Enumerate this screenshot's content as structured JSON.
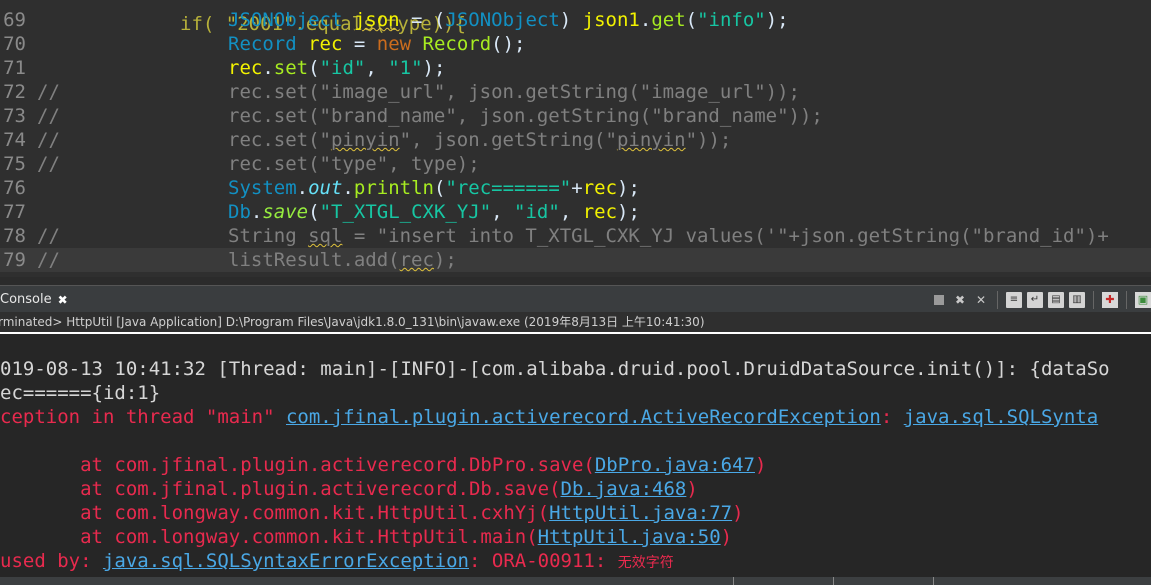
{
  "editor": {
    "top_fragment": "if( \"2001\".equals(type)){",
    "lines": [
      {
        "num": "69",
        "comment": "",
        "tokens": [
          {
            "t": "JSONObject",
            "c": "type"
          },
          {
            "t": " "
          },
          {
            "t": "json",
            "c": "var",
            "sq": true
          },
          {
            "t": " = ("
          },
          {
            "t": "JSONObject",
            "c": "type"
          },
          {
            "t": ") "
          },
          {
            "t": "json1",
            "c": "var"
          },
          {
            "t": "."
          },
          {
            "t": "get",
            "c": "method"
          },
          {
            "t": "("
          },
          {
            "t": "\"info\"",
            "c": "str"
          },
          {
            "t": ");"
          }
        ]
      },
      {
        "num": "70",
        "comment": "",
        "tokens": [
          {
            "t": "Record",
            "c": "type"
          },
          {
            "t": " "
          },
          {
            "t": "rec",
            "c": "var"
          },
          {
            "t": " = "
          },
          {
            "t": "new",
            "c": "kw"
          },
          {
            "t": " "
          },
          {
            "t": "Record",
            "c": "method"
          },
          {
            "t": "();"
          }
        ]
      },
      {
        "num": "71",
        "comment": "",
        "tokens": [
          {
            "t": "rec",
            "c": "var"
          },
          {
            "t": "."
          },
          {
            "t": "set",
            "c": "method"
          },
          {
            "t": "("
          },
          {
            "t": "\"id\"",
            "c": "str"
          },
          {
            "t": ", "
          },
          {
            "t": "\"1\"",
            "c": "str"
          },
          {
            "t": ");"
          }
        ]
      },
      {
        "num": "72",
        "comment": "//",
        "tokens": [
          {
            "t": "rec.set(\"image_url\", json.getString(\"image_url\"));",
            "c": "cm"
          }
        ]
      },
      {
        "num": "73",
        "comment": "//",
        "tokens": [
          {
            "t": "rec.set(\"brand_name\", json.getString(\"brand_name\"));",
            "c": "cm"
          }
        ]
      },
      {
        "num": "74",
        "comment": "//",
        "tokens": [
          {
            "t": "rec.set(\"",
            "c": "cm"
          },
          {
            "t": "pinyin",
            "c": "cm",
            "sq": true
          },
          {
            "t": "\", json.getString(\"",
            "c": "cm"
          },
          {
            "t": "pinyin",
            "c": "cm",
            "sq": true
          },
          {
            "t": "\"));",
            "c": "cm"
          }
        ]
      },
      {
        "num": "75",
        "comment": "//",
        "tokens": [
          {
            "t": "rec.set(\"type\", type);",
            "c": "cm"
          }
        ]
      },
      {
        "num": "76",
        "comment": "",
        "tokens": [
          {
            "t": "System",
            "c": "type"
          },
          {
            "t": "."
          },
          {
            "t": "out",
            "c": "field"
          },
          {
            "t": "."
          },
          {
            "t": "println",
            "c": "method"
          },
          {
            "t": "("
          },
          {
            "t": "\"rec======\"",
            "c": "str"
          },
          {
            "t": "+"
          },
          {
            "t": "rec",
            "c": "var"
          },
          {
            "t": ");"
          }
        ]
      },
      {
        "num": "77",
        "comment": "",
        "tokens": [
          {
            "t": "Db",
            "c": "type"
          },
          {
            "t": "."
          },
          {
            "t": "save",
            "c": "smethod"
          },
          {
            "t": "("
          },
          {
            "t": "\"T_XTGL_CXK_YJ\"",
            "c": "str"
          },
          {
            "t": ", "
          },
          {
            "t": "\"id\"",
            "c": "str"
          },
          {
            "t": ", "
          },
          {
            "t": "rec",
            "c": "var"
          },
          {
            "t": ");"
          }
        ]
      },
      {
        "num": "78",
        "comment": "//",
        "tokens": [
          {
            "t": "String ",
            "c": "cm"
          },
          {
            "t": "sql",
            "c": "cm",
            "sq": true
          },
          {
            "t": " = \"insert into T_XTGL_CXK_YJ values('\"+json.getString(\"brand_id\")+",
            "c": "cm"
          }
        ]
      },
      {
        "num": "79",
        "comment": "//",
        "current": true,
        "tokens": [
          {
            "t": "listResult.add(",
            "c": "cm"
          },
          {
            "t": "rec",
            "c": "cm",
            "sq": true
          },
          {
            "t": ");",
            "c": "cm"
          }
        ]
      }
    ]
  },
  "console": {
    "tab_label": "Console",
    "status": "rminated> HttpUtil [Java Application] D:\\Program Files\\Java\\jdk1.8.0_131\\bin\\javaw.exe (2019年8月13日 上午10:41:30)",
    "toolbar_icons": [
      "terminate-icon",
      "remove-launch-icon",
      "remove-all-icon",
      "scroll-lock-icon",
      "word-wrap-icon",
      "show-stdout-icon",
      "show-stderr-icon",
      "pin-console-icon",
      "open-console-icon"
    ],
    "output": [
      {
        "kind": "info",
        "parts": [
          {
            "t": "019-08-13 10:41:32 [Thread: main]-[INFO]-[com.alibaba.druid.pool.DruidDataSource.init()]: {dataSo"
          }
        ]
      },
      {
        "kind": "info",
        "parts": [
          {
            "t": "ec======{id:1}"
          }
        ]
      },
      {
        "kind": "err",
        "parts": [
          {
            "t": "ception in thread \"main\" "
          },
          {
            "t": "com.jfinal.plugin.activerecord.ActiveRecordException",
            "link": true
          },
          {
            "t": ": "
          },
          {
            "t": "java.sql.SQLSynta",
            "link": true
          }
        ]
      },
      {
        "kind": "err",
        "parts": [
          {
            "t": ""
          }
        ]
      },
      {
        "kind": "err",
        "parts": [
          {
            "t": "       at com.jfinal.plugin.activerecord.DbPro.save("
          },
          {
            "t": "DbPro.java:647",
            "link": true
          },
          {
            "t": ")"
          }
        ]
      },
      {
        "kind": "err",
        "parts": [
          {
            "t": "       at com.jfinal.plugin.activerecord.Db.save("
          },
          {
            "t": "Db.java:468",
            "link": true
          },
          {
            "t": ")"
          }
        ]
      },
      {
        "kind": "err",
        "parts": [
          {
            "t": "       at com.longway.common.kit.HttpUtil.cxhYj("
          },
          {
            "t": "HttpUtil.java:77",
            "link": true
          },
          {
            "t": ")"
          }
        ]
      },
      {
        "kind": "err",
        "parts": [
          {
            "t": "       at com.longway.common.kit.HttpUtil.main("
          },
          {
            "t": "HttpUtil.java:50",
            "link": true
          },
          {
            "t": ")"
          }
        ]
      },
      {
        "kind": "err",
        "parts": [
          {
            "t": "used by: "
          },
          {
            "t": "java.sql.SQLSyntaxErrorException",
            "link": true
          },
          {
            "t": ": ORA-00911: "
          },
          {
            "t": "无效字符",
            "cjk": true
          }
        ]
      }
    ]
  },
  "colors": {
    "editor_bg": "#2f2f2f",
    "console_bg": "#262626",
    "error": "#e82a4e",
    "link": "#4aa8e6",
    "string": "#17c6a3",
    "keyword": "#cc6c1d",
    "type": "#1290c3",
    "variable": "#f2f200"
  }
}
